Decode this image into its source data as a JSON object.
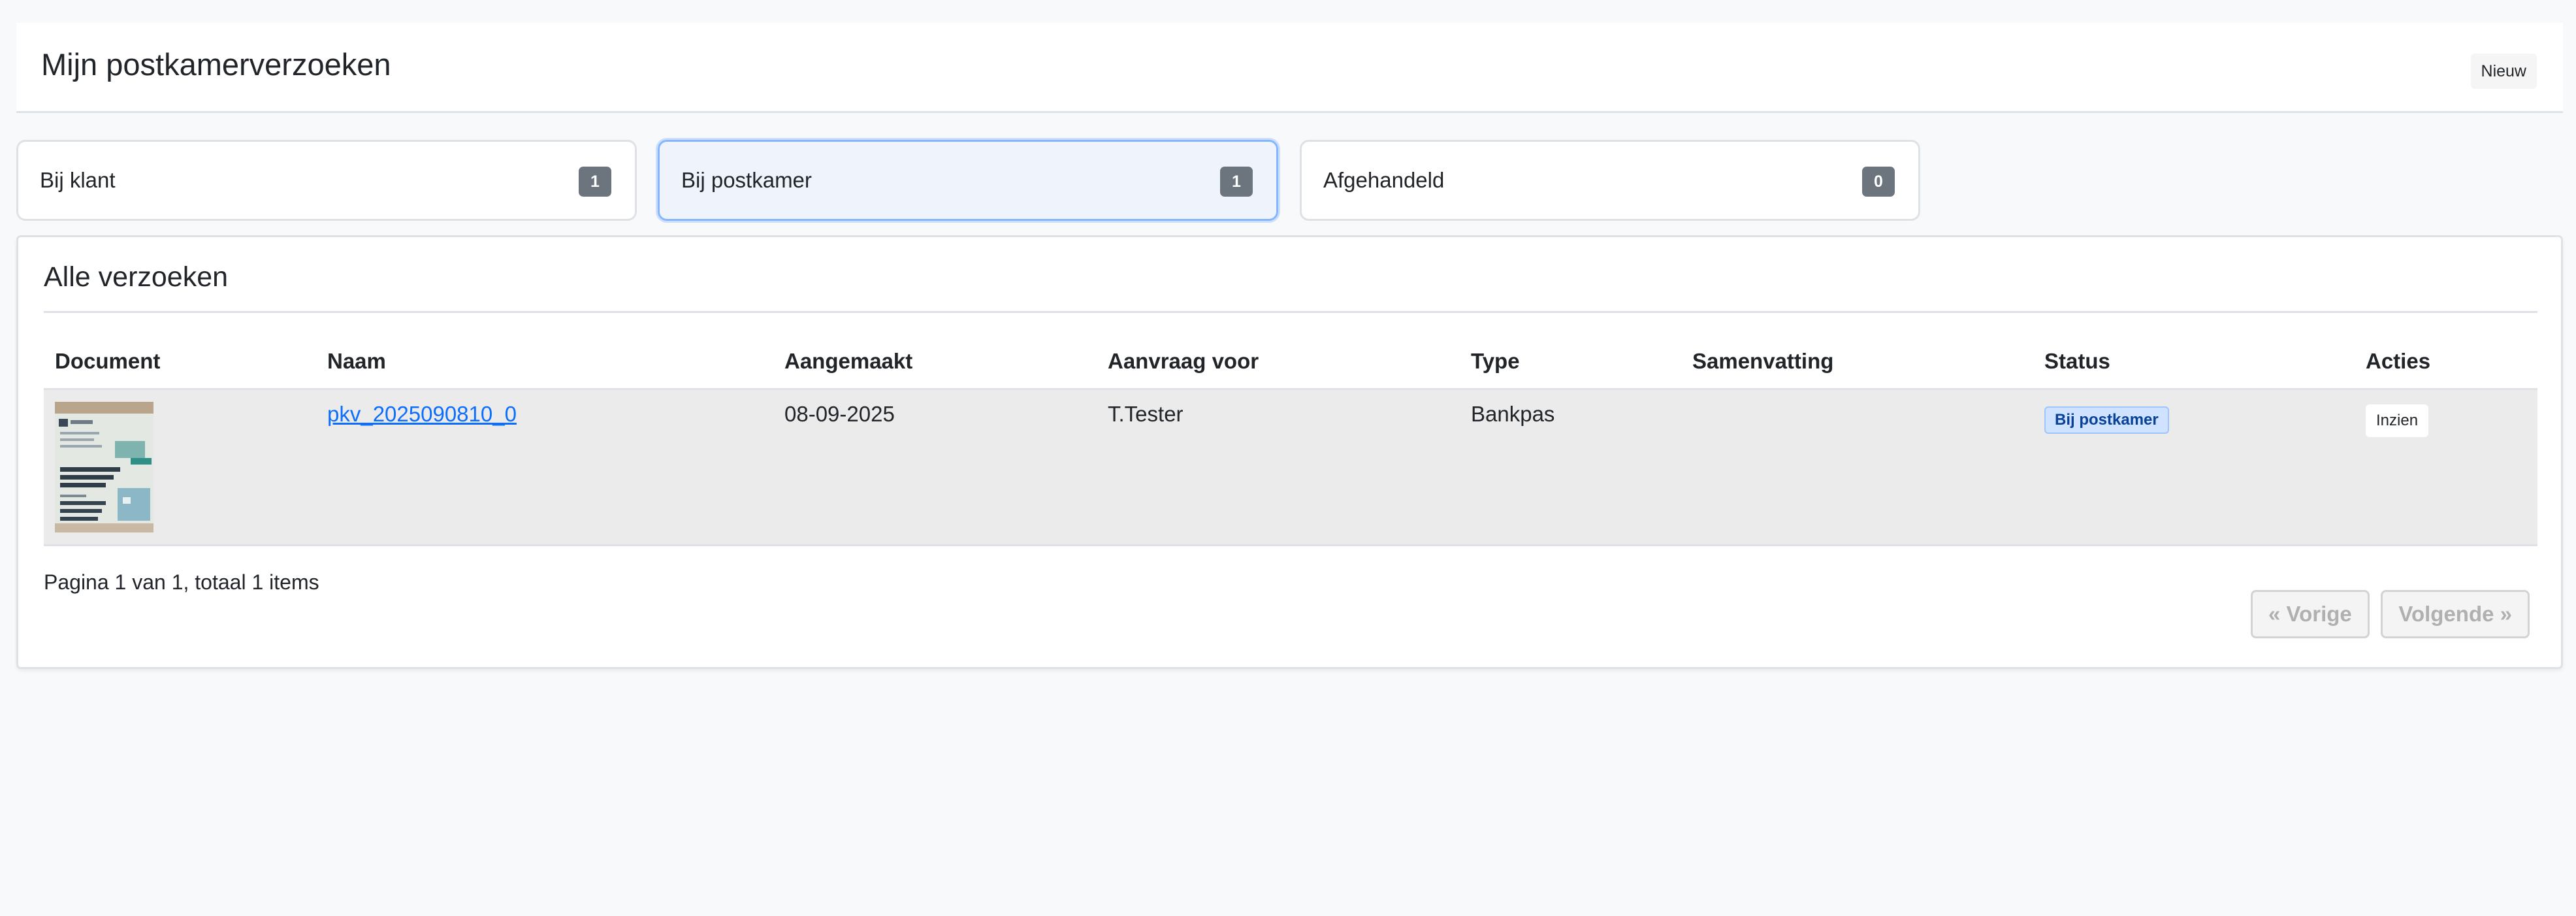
{
  "header": {
    "title": "Mijn postkamerverzoeken",
    "new_label": "Nieuw"
  },
  "tabs": [
    {
      "label": "Bij klant",
      "count": "1",
      "active": false
    },
    {
      "label": "Bij postkamer",
      "count": "1",
      "active": true
    },
    {
      "label": "Afgehandeld",
      "count": "0",
      "active": false
    }
  ],
  "requests": {
    "title": "Alle verzoeken",
    "columns": [
      "Document",
      "Naam",
      "Aangemaakt",
      "Aanvraag voor",
      "Type",
      "Samenvatting",
      "Status",
      "Acties"
    ],
    "rows": [
      {
        "name": "pkv_2025090810_0",
        "created": "08-09-2025",
        "requested_for": "T.Tester",
        "type": "Bankpas",
        "summary": "",
        "status": "Bij postkamer",
        "action_label": "Inzien"
      }
    ]
  },
  "pagination": {
    "summary": "Pagina 1 van 1, totaal 1 items",
    "prev_label": "« Vorige",
    "next_label": "Volgende »"
  },
  "colors": {
    "accent": "#0d6efd",
    "tab_active_border": "#86b7fe",
    "badge_gray": "#6c757d",
    "status_badge_bg": "#cfe2ff"
  },
  "icons": {
    "document_thumbnail": "document-scan-thumbnail"
  }
}
